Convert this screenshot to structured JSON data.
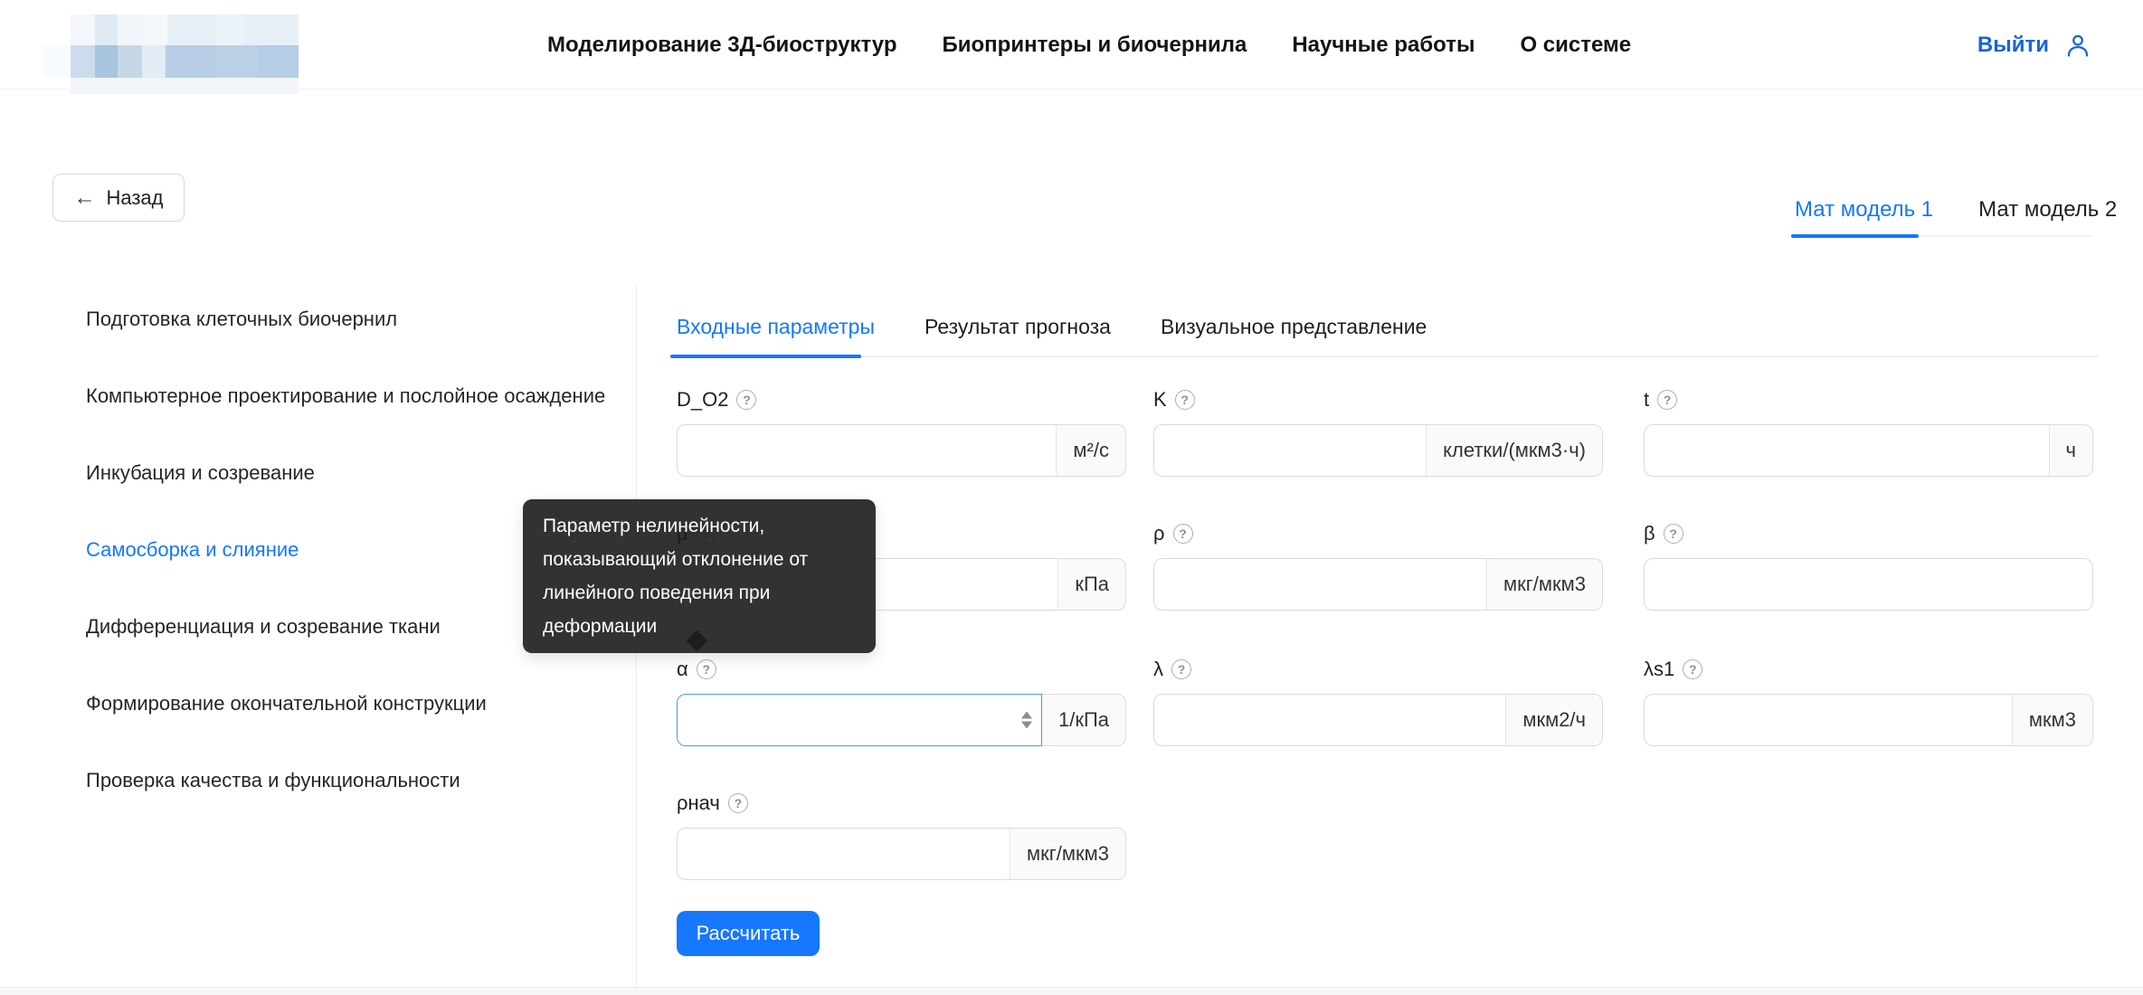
{
  "header": {
    "nav": [
      {
        "label": "Моделирование 3Д-биоструктур"
      },
      {
        "label": "Биопринтеры и биочернила"
      },
      {
        "label": "Научные работы"
      },
      {
        "label": "О системе"
      }
    ],
    "logout_label": "Выйти"
  },
  "back_button": {
    "arrow": "←",
    "label": "Назад"
  },
  "model_tabs": {
    "items": [
      {
        "label": "Мат модель 1",
        "active": true
      },
      {
        "label": "Мат модель 2",
        "active": false
      }
    ]
  },
  "sidebar": {
    "items": [
      {
        "label": "Подготовка клеточных биочернил",
        "active": false
      },
      {
        "label": "Компьютерное проектирование и послойное осаждение",
        "active": false
      },
      {
        "label": "Инкубация и созревание",
        "active": false
      },
      {
        "label": "Самосборка и слияние",
        "active": true
      },
      {
        "label": "Дифференциация и созревание ткани",
        "active": false
      },
      {
        "label": "Формирование окончательной конструкции",
        "active": false
      },
      {
        "label": "Проверка качества и функциональности",
        "active": false
      }
    ]
  },
  "main_tabs": {
    "items": [
      {
        "label": "Входные параметры",
        "active": true
      },
      {
        "label": "Результат прогноза",
        "active": false
      },
      {
        "label": "Визуальное представление",
        "active": false
      }
    ]
  },
  "form": {
    "fields": [
      {
        "label": "D_O2",
        "unit": "м²/с",
        "value": ""
      },
      {
        "label": "K",
        "unit": "клетки/(мкм3·ч)",
        "value": ""
      },
      {
        "label": "t",
        "unit": "ч",
        "value": ""
      },
      {
        "label": "μ",
        "unit": "кПа",
        "value": ""
      },
      {
        "label": "ρ",
        "unit": "мкг/мкм3",
        "value": ""
      },
      {
        "label": "β",
        "unit": "",
        "value": ""
      },
      {
        "label": "α",
        "unit": "1/кПа",
        "value": ""
      },
      {
        "label": "λ",
        "unit": "мкм2/ч",
        "value": ""
      },
      {
        "label": "λs1",
        "unit": "мкм3",
        "value": ""
      },
      {
        "label": "ρнач",
        "unit": "мкг/мкм3",
        "value": ""
      }
    ],
    "submit_label": "Рассчитать"
  },
  "tooltip": {
    "text": "Параметр нелинейности, показывающий отклонение от линейного поведения при деформации"
  },
  "colors": {
    "accent": "#1677ff",
    "tooltip_bg": "#1c1c1c",
    "border": "#d9d9d9"
  }
}
